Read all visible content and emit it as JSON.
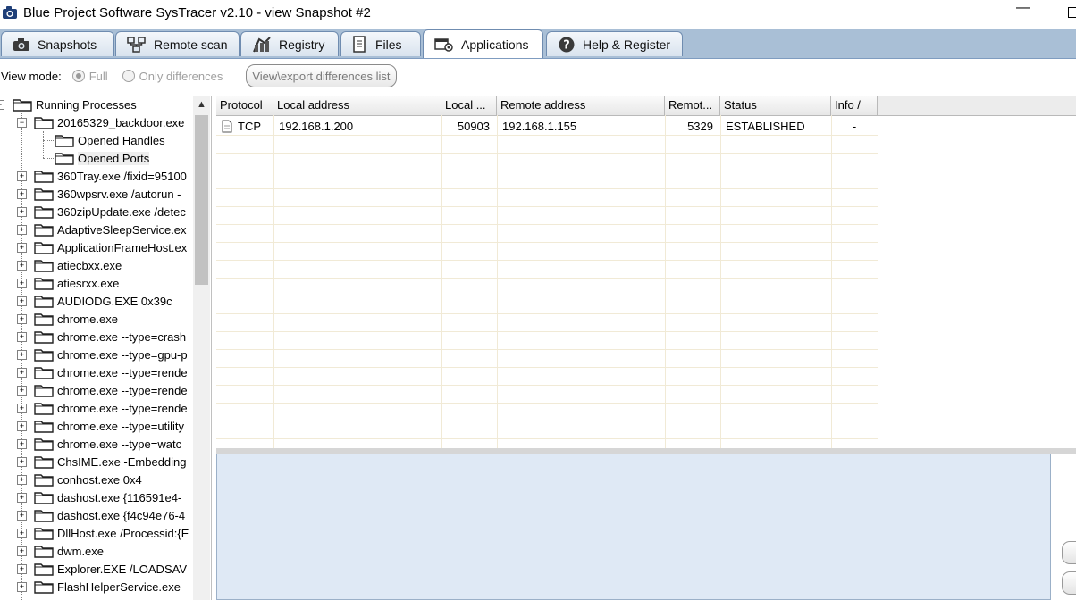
{
  "window": {
    "title": "Blue Project Software SysTracer v2.10 - view Snapshot #2",
    "minimize_glyph": "—"
  },
  "tabs": [
    {
      "label": "Snapshots",
      "icon": "camera-icon"
    },
    {
      "label": "Remote scan",
      "icon": "network-icon"
    },
    {
      "label": "Registry",
      "icon": "registry-icon"
    },
    {
      "label": "Files",
      "icon": "files-icon"
    },
    {
      "label": "Applications",
      "icon": "applications-icon",
      "active": true
    },
    {
      "label": "Help & Register",
      "icon": "help-icon"
    }
  ],
  "toolbar": {
    "view_mode_label": "View mode:",
    "option_full": "Full",
    "option_diff": "Only differences",
    "export_button": "View\\export differences list"
  },
  "tree": {
    "root": "Running Processes",
    "expanded_process": "20165329_backdoor.exe",
    "children": [
      "Opened Handles",
      "Opened Ports"
    ],
    "processes": [
      "360Tray.exe /fixid=95100",
      "360wpsrv.exe /autorun -",
      "360zipUpdate.exe /detec",
      "AdaptiveSleepService.ex",
      "ApplicationFrameHost.ex",
      "atiecbxx.exe",
      "atiesrxx.exe",
      "AUDIODG.EXE 0x39c",
      "chrome.exe",
      "chrome.exe --type=crash",
      "chrome.exe --type=gpu-p",
      "chrome.exe --type=rende",
      "chrome.exe --type=rende",
      "chrome.exe --type=rende",
      "chrome.exe --type=utility",
      "chrome.exe --type=watc",
      "ChsIME.exe -Embedding",
      "conhost.exe 0x4",
      "dashost.exe {116591e4-",
      "dashost.exe {f4c94e76-4",
      "DllHost.exe /Processid:{E",
      "dwm.exe",
      "Explorer.EXE /LOADSAV",
      "FlashHelperService.exe"
    ]
  },
  "ports_table": {
    "columns": [
      "Protocol",
      "Local address",
      "Local ...",
      "Remote address",
      "Remot...",
      "Status",
      "Info /"
    ],
    "rows": [
      {
        "protocol": "TCP",
        "local_address": "192.168.1.200",
        "local_port": "50903",
        "remote_address": "192.168.1.155",
        "remote_port": "5329",
        "status": "ESTABLISHED",
        "info": "-"
      }
    ]
  },
  "colors": {
    "tab_strip": "#a9bfd6",
    "detail_panel": "#dfe9f5",
    "grid_line": "#f1ead6"
  }
}
